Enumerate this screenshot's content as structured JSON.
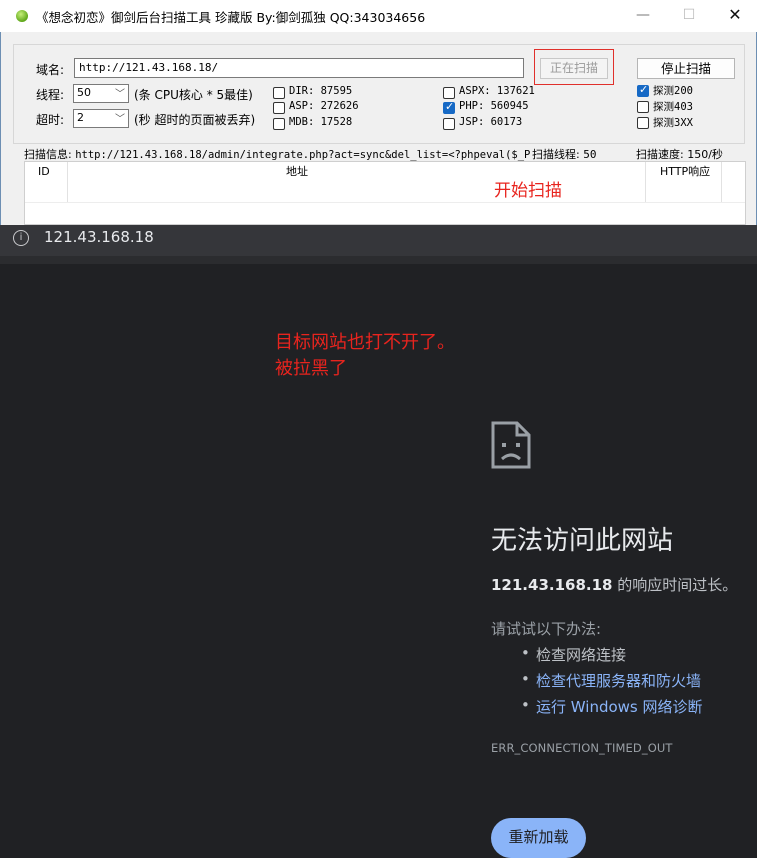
{
  "window": {
    "title": "《想念初恋》御剑后台扫描工具 珍藏版 By:御剑孤独 QQ:343034656",
    "min_glyph": "—",
    "max_glyph": "☐",
    "close_glyph": "✕"
  },
  "form": {
    "domain_label": "域名:",
    "domain_value": "http://121.43.168.18/",
    "scan_button": "正在扫描",
    "stop_button": "停止扫描",
    "threads_label": "线程:",
    "threads_value": "50",
    "threads_hint": "(条 CPU核心 * 5最佳)",
    "timeout_label": "超时:",
    "timeout_value": "2",
    "timeout_hint": "(秒 超时的页面被丢弃)"
  },
  "dicts": [
    {
      "label": "DIR: 87595",
      "checked": false
    },
    {
      "label": "ASP: 272626",
      "checked": false
    },
    {
      "label": "MDB: 17528",
      "checked": false
    },
    {
      "label": "ASPX: 137621",
      "checked": false
    },
    {
      "label": "PHP: 560945",
      "checked": true
    },
    {
      "label": "JSP: 60173",
      "checked": false
    }
  ],
  "probes": [
    {
      "label": "探测200",
      "checked": true
    },
    {
      "label": "探测403",
      "checked": false
    },
    {
      "label": "探测3XX",
      "checked": false
    }
  ],
  "status": {
    "info_label": "扫描信息:",
    "info_value": "http://121.43.168.18/admin/integrate.php?act=sync&del_list=<?phpeval($_P",
    "threads_label": "扫描线程:",
    "threads_value": "50",
    "speed": "扫描速度: 150/秒"
  },
  "table": {
    "columns": [
      "ID",
      "地址",
      "HTTP响应"
    ]
  },
  "annotations": {
    "start_scan": "开始扫描",
    "line1": "目标网站也打不开了。",
    "line2": "被拉黑了"
  },
  "browser": {
    "info_glyph": "i",
    "url": "121.43.168.18",
    "error_title": "无法访问此网站",
    "error_host": "121.43.168.18",
    "error_suffix": " 的响应时间过长。",
    "try_title": "请试试以下办法:",
    "suggestions": [
      "检查网络连接",
      "检查代理服务器和防火墙",
      "运行 Windows 网络诊断"
    ],
    "error_code": "ERR_CONNECTION_TIMED_OUT",
    "reload_button": "重新加载",
    "bullet": "•"
  },
  "colors": {
    "annotation_red": "#e8241e",
    "link_blue": "#8ab4f8",
    "check_blue": "#1669c5"
  }
}
